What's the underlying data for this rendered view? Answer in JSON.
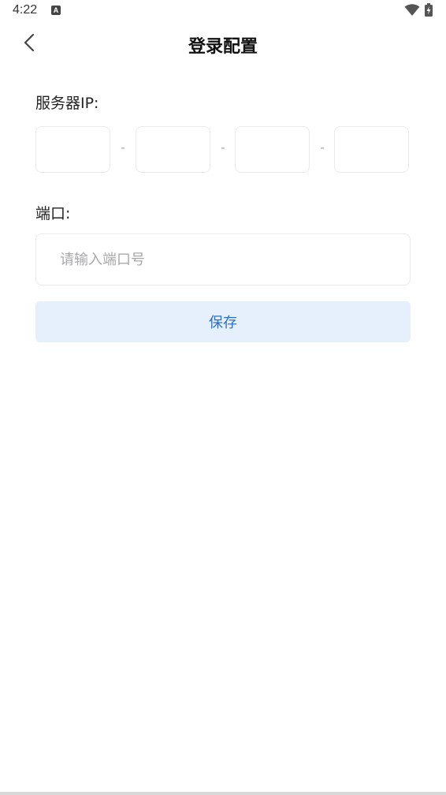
{
  "status_bar": {
    "time": "4:22",
    "notification_icon": "a-icon",
    "notification_letter": "A",
    "wifi_icon": "wifi-icon",
    "battery_icon": "battery-charging-icon"
  },
  "header": {
    "back_icon": "chevron-left-icon",
    "title": "登录配置"
  },
  "form": {
    "server_ip_label": "服务器IP:",
    "ip_fields": [
      {
        "value": ""
      },
      {
        "value": ""
      },
      {
        "value": ""
      },
      {
        "value": ""
      }
    ],
    "ip_separator": "-",
    "port_label": "端口:",
    "port_placeholder": "请输入端口号",
    "port_value": "",
    "save_label": "保存"
  },
  "colors": {
    "save_button_bg": "#e5f0fc",
    "save_button_text": "#2f6fc0",
    "input_border": "#e9eaee",
    "placeholder": "#a9a9ad"
  }
}
